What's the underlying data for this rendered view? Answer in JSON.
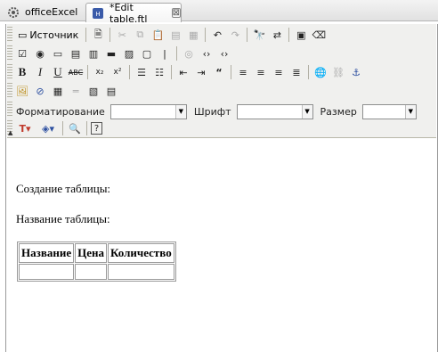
{
  "tabs": [
    {
      "label": "officeExcel",
      "icon": "gear-icon",
      "active": false
    },
    {
      "label": "*Edit table.ftl",
      "icon": "html-file-icon",
      "active": true,
      "close": "⊠"
    }
  ],
  "toolbar": {
    "source_label": "Источник",
    "format_label": "Форматирование",
    "font_label": "Шрифт",
    "size_label": "Размер",
    "format_value": "",
    "font_value": "",
    "size_value": ""
  },
  "document": {
    "line1": "Создание таблицы:",
    "line2": "Название таблицы:",
    "table": {
      "headers": [
        "Название",
        "Цена",
        "Количество"
      ],
      "rows": [
        [
          "",
          "",
          ""
        ]
      ]
    }
  }
}
